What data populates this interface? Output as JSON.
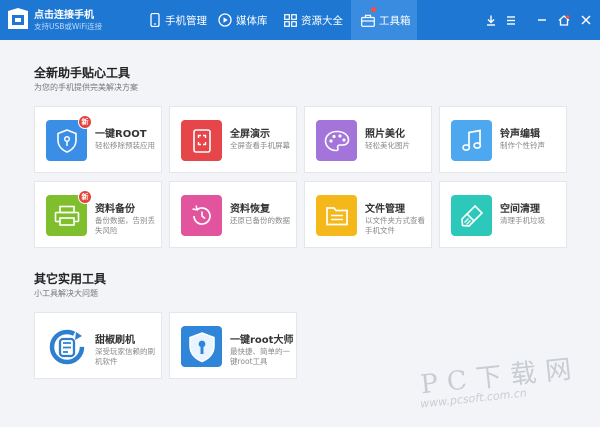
{
  "header": {
    "connect_title": "点击连接手机",
    "connect_subtitle": "支持USB或WiFi连接",
    "tabs": [
      {
        "label": "手机管理",
        "icon": "phone-icon"
      },
      {
        "label": "媒体库",
        "icon": "play-circle-icon"
      },
      {
        "label": "资源大全",
        "icon": "grid-icon"
      },
      {
        "label": "工具箱",
        "icon": "toolbox-icon",
        "active": true
      }
    ],
    "window_controls": [
      "download-icon",
      "menu-icon",
      "minimize-icon",
      "home-icon",
      "close-icon"
    ]
  },
  "sections": [
    {
      "title": "全新助手贴心工具",
      "subtitle": "为您的手机提供完美解决方案",
      "tools": [
        {
          "name": "一键ROOT",
          "desc": "轻松移除预装应用",
          "color": "#3a8ee6",
          "icon": "shield-key-icon",
          "badge": "新"
        },
        {
          "name": "全屏演示",
          "desc": "全屏查看手机屏幕",
          "color": "#e6454a",
          "icon": "fullscreen-icon"
        },
        {
          "name": "照片美化",
          "desc": "轻松美化图片",
          "color": "#a374d9",
          "icon": "palette-icon"
        },
        {
          "name": "铃声编辑",
          "desc": "制作个性铃声",
          "color": "#4ea8f0",
          "icon": "music-note-icon"
        },
        {
          "name": "资料备份",
          "desc": "备份数据，告别丢失风险",
          "color": "#7fbe2c",
          "icon": "printer-backup-icon",
          "badge": "新"
        },
        {
          "name": "资料恢复",
          "desc": "还原已备份的数据",
          "color": "#e2549e",
          "icon": "clock-restore-icon"
        },
        {
          "name": "文件管理",
          "desc": "以文件夹方式查看手机文件",
          "color": "#f5b81a",
          "icon": "folder-icon"
        },
        {
          "name": "空间清理",
          "desc": "清理手机垃圾",
          "color": "#2cc9bb",
          "icon": "brush-icon"
        }
      ]
    },
    {
      "title": "其它实用工具",
      "subtitle": "小工具解决大问题",
      "tools": [
        {
          "name": "甜椒刷机",
          "desc": "深受玩家信赖的刷机软件",
          "color": "#2d7fd0",
          "icon": "refresh-flash-icon"
        },
        {
          "name": "一键root大师",
          "desc": "最快捷、简单的一键root工具",
          "color": "#2f86d8",
          "icon": "root-shield-icon"
        }
      ]
    }
  ],
  "watermark": {
    "text": "PC下载网",
    "url": "www.pcsoft.com.cn"
  }
}
